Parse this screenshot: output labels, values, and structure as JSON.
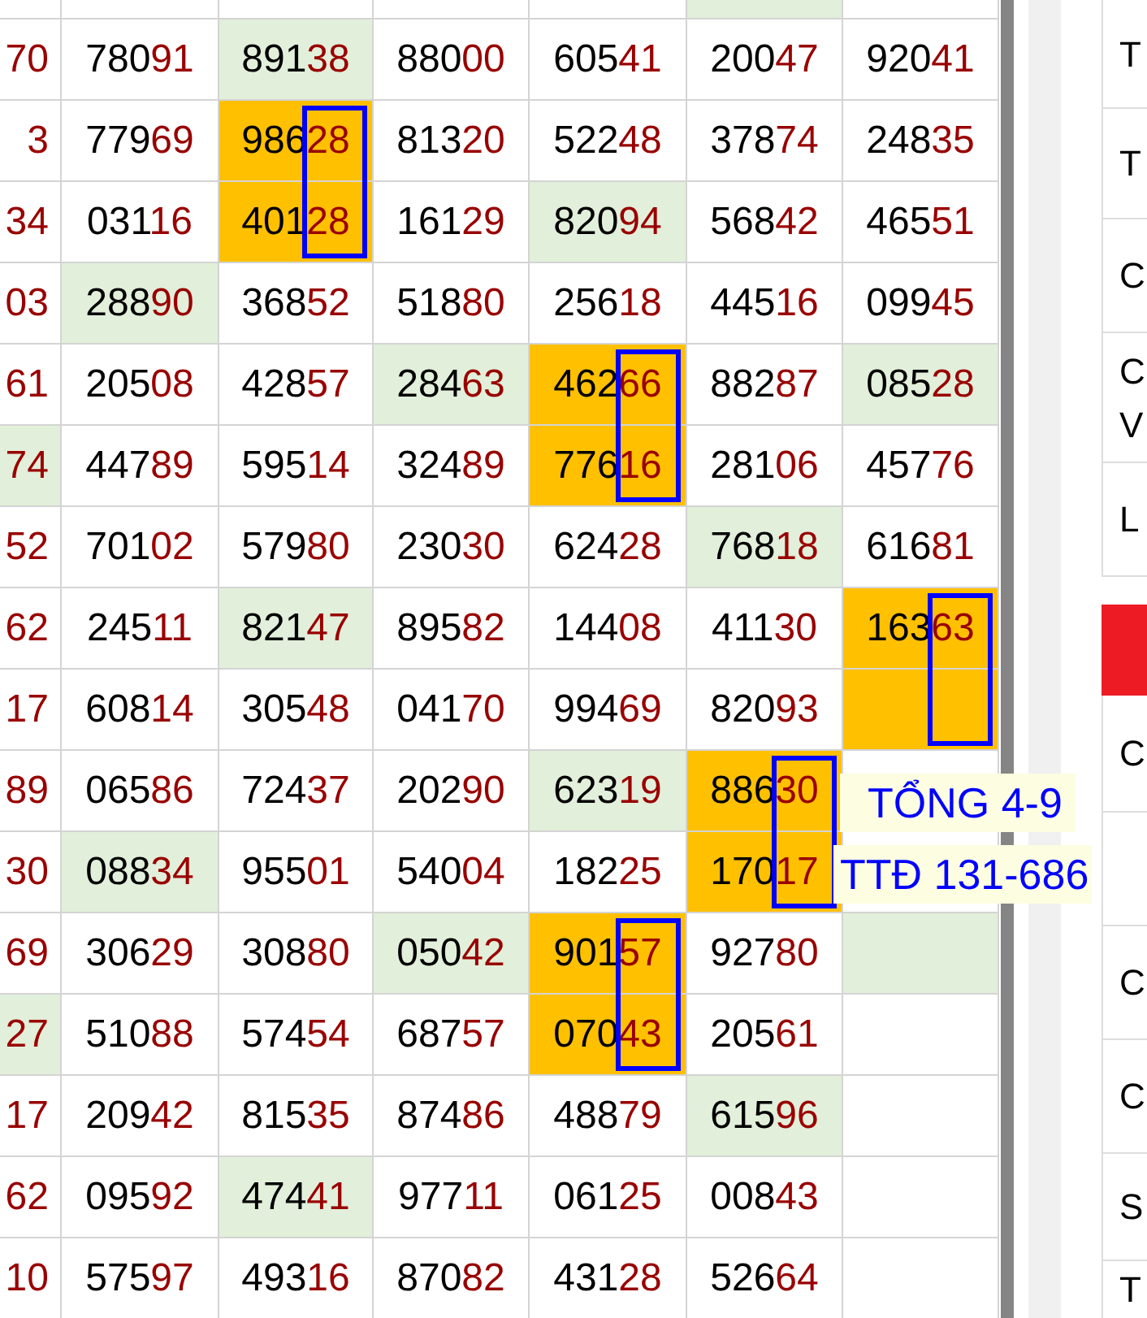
{
  "table": {
    "rows": [
      {
        "cells": [
          {
            "color": "#ffffff",
            "boxed": false
          },
          {
            "color": "#ffffff",
            "boxed": false
          },
          {
            "color": "#ffffff",
            "boxed": false
          },
          {
            "color": "#ffffff",
            "boxed": false
          },
          {
            "color": "#ffffff",
            "boxed": false
          },
          {
            "color": "#e2efda",
            "boxed": false
          },
          {
            "color": "#ffffff",
            "boxed": false
          }
        ]
      },
      {
        "cells": [
          {
            "text": "70",
            "color": "#ffffff",
            "boxed": false
          },
          {
            "text": "78091",
            "color": "#ffffff",
            "boxed": false
          },
          {
            "text": "89138",
            "color": "#e2efda",
            "boxed": false
          },
          {
            "text": "88000",
            "color": "#ffffff",
            "boxed": false
          },
          {
            "text": "60541",
            "color": "#ffffff",
            "boxed": false
          },
          {
            "text": "20047",
            "color": "#ffffff",
            "boxed": false
          },
          {
            "text": "92041",
            "color": "#ffffff",
            "boxed": false
          }
        ]
      },
      {
        "cells": [
          {
            "text": "3",
            "color": "#ffffff",
            "boxed": false
          },
          {
            "text": "77969",
            "color": "#ffffff",
            "boxed": false
          },
          {
            "text": "98628",
            "color": "#ffc000",
            "boxed": true
          },
          {
            "text": "81320",
            "color": "#ffffff",
            "boxed": false
          },
          {
            "text": "52248",
            "color": "#ffffff",
            "boxed": false
          },
          {
            "text": "37874",
            "color": "#ffffff",
            "boxed": false
          },
          {
            "text": "24835",
            "color": "#ffffff",
            "boxed": false
          }
        ]
      },
      {
        "cells": [
          {
            "text": "34",
            "color": "#ffffff",
            "boxed": false
          },
          {
            "text": "03116",
            "color": "#ffffff",
            "boxed": false
          },
          {
            "text": "40128",
            "color": "#ffc000",
            "boxed": true
          },
          {
            "text": "16129",
            "color": "#ffffff",
            "boxed": false
          },
          {
            "text": "82094",
            "color": "#e2efda",
            "boxed": false
          },
          {
            "text": "56842",
            "color": "#ffffff",
            "boxed": false
          },
          {
            "text": "46551",
            "color": "#ffffff",
            "boxed": false
          }
        ]
      },
      {
        "cells": [
          {
            "text": "03",
            "color": "#ffffff",
            "boxed": false
          },
          {
            "text": "28890",
            "color": "#e2efda",
            "boxed": false
          },
          {
            "text": "36852",
            "color": "#ffffff",
            "boxed": false
          },
          {
            "text": "51880",
            "color": "#ffffff",
            "boxed": false
          },
          {
            "text": "25618",
            "color": "#ffffff",
            "boxed": false
          },
          {
            "text": "44516",
            "color": "#ffffff",
            "boxed": false
          },
          {
            "text": "09945",
            "color": "#ffffff",
            "boxed": false
          }
        ]
      },
      {
        "cells": [
          {
            "text": "61",
            "color": "#ffffff",
            "boxed": false
          },
          {
            "text": "20508",
            "color": "#ffffff",
            "boxed": false
          },
          {
            "text": "42857",
            "color": "#ffffff",
            "boxed": false
          },
          {
            "text": "28463",
            "color": "#e2efda",
            "boxed": false
          },
          {
            "text": "46266",
            "color": "#ffc000",
            "boxed": true
          },
          {
            "text": "88287",
            "color": "#ffffff",
            "boxed": false
          },
          {
            "text": "08528",
            "color": "#e2efda",
            "boxed": false
          }
        ]
      },
      {
        "cells": [
          {
            "text": "74",
            "color": "#e2efda",
            "boxed": false
          },
          {
            "text": "44789",
            "color": "#ffffff",
            "boxed": false
          },
          {
            "text": "59514",
            "color": "#ffffff",
            "boxed": false
          },
          {
            "text": "32489",
            "color": "#ffffff",
            "boxed": false
          },
          {
            "text": "77616",
            "color": "#ffc000",
            "boxed": true
          },
          {
            "text": "28106",
            "color": "#ffffff",
            "boxed": false
          },
          {
            "text": "45776",
            "color": "#ffffff",
            "boxed": false
          }
        ]
      },
      {
        "cells": [
          {
            "text": "52",
            "color": "#ffffff",
            "boxed": false
          },
          {
            "text": "70102",
            "color": "#ffffff",
            "boxed": false
          },
          {
            "text": "57980",
            "color": "#ffffff",
            "boxed": false
          },
          {
            "text": "23030",
            "color": "#ffffff",
            "boxed": false
          },
          {
            "text": "62428",
            "color": "#ffffff",
            "boxed": false
          },
          {
            "text": "76818",
            "color": "#e2efda",
            "boxed": false
          },
          {
            "text": "61681",
            "color": "#ffffff",
            "boxed": false
          }
        ]
      },
      {
        "cells": [
          {
            "text": "62",
            "color": "#ffffff",
            "boxed": false
          },
          {
            "text": "24511",
            "color": "#ffffff",
            "boxed": false
          },
          {
            "text": "82147",
            "color": "#e2efda",
            "boxed": false
          },
          {
            "text": "89582",
            "color": "#ffffff",
            "boxed": false
          },
          {
            "text": "14408",
            "color": "#ffffff",
            "boxed": false
          },
          {
            "text": "41130",
            "color": "#ffffff",
            "boxed": false
          },
          {
            "text": "16363",
            "color": "#ffc000",
            "boxed": true
          }
        ]
      },
      {
        "cells": [
          {
            "text": "17",
            "color": "#ffffff",
            "boxed": false
          },
          {
            "text": "60814",
            "color": "#ffffff",
            "boxed": false
          },
          {
            "text": "30548",
            "color": "#ffffff",
            "boxed": false
          },
          {
            "text": "04170",
            "color": "#ffffff",
            "boxed": false
          },
          {
            "text": "99469",
            "color": "#ffffff",
            "boxed": false
          },
          {
            "text": "82093",
            "color": "#ffffff",
            "boxed": false
          },
          {
            "color": "#ffc000",
            "boxed": true
          }
        ]
      },
      {
        "cells": [
          {
            "text": "89",
            "color": "#ffffff",
            "boxed": false
          },
          {
            "text": "06586",
            "color": "#ffffff",
            "boxed": false
          },
          {
            "text": "72437",
            "color": "#ffffff",
            "boxed": false
          },
          {
            "text": "20290",
            "color": "#ffffff",
            "boxed": false
          },
          {
            "text": "62319",
            "color": "#e2efda",
            "boxed": false
          },
          {
            "text": "88630",
            "color": "#ffc000",
            "boxed": true
          },
          {
            "color": "#ffffff",
            "boxed": false
          }
        ]
      },
      {
        "cells": [
          {
            "text": "30",
            "color": "#ffffff",
            "boxed": false
          },
          {
            "text": "08834",
            "color": "#e2efda",
            "boxed": false
          },
          {
            "text": "95501",
            "color": "#ffffff",
            "boxed": false
          },
          {
            "text": "54004",
            "color": "#ffffff",
            "boxed": false
          },
          {
            "text": "18225",
            "color": "#ffffff",
            "boxed": false
          },
          {
            "text": "17017",
            "color": "#ffc000",
            "boxed": true
          },
          {
            "color": "#ffffff",
            "boxed": false
          }
        ]
      },
      {
        "cells": [
          {
            "text": "69",
            "color": "#ffffff",
            "boxed": false
          },
          {
            "text": "30629",
            "color": "#ffffff",
            "boxed": false
          },
          {
            "text": "30880",
            "color": "#ffffff",
            "boxed": false
          },
          {
            "text": "05042",
            "color": "#e2efda",
            "boxed": false
          },
          {
            "text": "90157",
            "color": "#ffc000",
            "boxed": true
          },
          {
            "text": "92780",
            "color": "#ffffff",
            "boxed": false
          },
          {
            "color": "#e2efda",
            "boxed": false
          }
        ]
      },
      {
        "cells": [
          {
            "text": "27",
            "color": "#e2efda",
            "boxed": false
          },
          {
            "text": "51088",
            "color": "#ffffff",
            "boxed": false
          },
          {
            "text": "57454",
            "color": "#ffffff",
            "boxed": false
          },
          {
            "text": "68757",
            "color": "#ffffff",
            "boxed": false
          },
          {
            "text": "07043",
            "color": "#ffc000",
            "boxed": true
          },
          {
            "text": "20561",
            "color": "#ffffff",
            "boxed": false
          },
          {
            "color": "#ffffff",
            "boxed": false
          }
        ]
      },
      {
        "cells": [
          {
            "text": "17",
            "color": "#ffffff",
            "boxed": false
          },
          {
            "text": "20942",
            "color": "#ffffff",
            "boxed": false
          },
          {
            "text": "81535",
            "color": "#ffffff",
            "boxed": false
          },
          {
            "text": "87486",
            "color": "#ffffff",
            "boxed": false
          },
          {
            "text": "48879",
            "color": "#ffffff",
            "boxed": false
          },
          {
            "text": "61596",
            "color": "#e2efda",
            "boxed": false
          },
          {
            "color": "#ffffff",
            "boxed": false
          }
        ]
      },
      {
        "cells": [
          {
            "text": "62",
            "color": "#ffffff",
            "boxed": false
          },
          {
            "text": "09592",
            "color": "#ffffff",
            "boxed": false
          },
          {
            "text": "47441",
            "color": "#e2efda",
            "boxed": false
          },
          {
            "text": "97711",
            "color": "#ffffff",
            "boxed": false
          },
          {
            "text": "06125",
            "color": "#ffffff",
            "boxed": false
          },
          {
            "text": "00843",
            "color": "#ffffff",
            "boxed": false
          },
          {
            "color": "#ffffff",
            "boxed": false
          }
        ]
      },
      {
        "cells": [
          {
            "text": "10",
            "color": "#ffffff",
            "boxed": false
          },
          {
            "text": "57597",
            "color": "#ffffff",
            "boxed": false
          },
          {
            "text": "49316",
            "color": "#ffffff",
            "boxed": false
          },
          {
            "text": "87082",
            "color": "#ffffff",
            "boxed": false
          },
          {
            "text": "43128",
            "color": "#ffffff",
            "boxed": false
          },
          {
            "text": "52664",
            "color": "#ffffff",
            "boxed": false
          },
          {
            "color": "#ffffff",
            "boxed": false
          }
        ]
      }
    ]
  },
  "annotations": [
    "TỔNG 4-9",
    "TTĐ 131-686"
  ],
  "sidebar": {
    "top_items": [
      {
        "lines": [
          "T"
        ]
      },
      {
        "lines": [
          "T"
        ]
      },
      {
        "lines": [
          "C"
        ]
      },
      {
        "lines": [
          "C",
          "V"
        ]
      },
      {
        "lines": [
          "L"
        ]
      }
    ],
    "bottom_items": [
      {
        "lines": [
          "C"
        ]
      },
      {
        "lines": [
          "C"
        ]
      },
      {
        "lines": [
          "C"
        ]
      },
      {
        "lines": [
          "S"
        ]
      },
      {
        "lines": [
          "T"
        ]
      }
    ]
  }
}
